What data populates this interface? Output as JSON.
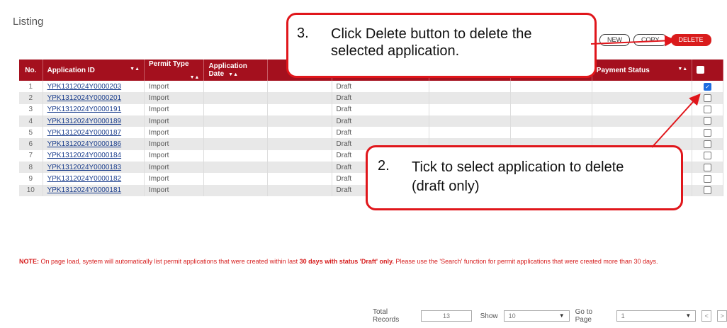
{
  "page": {
    "title": "Listing"
  },
  "toolbar": {
    "new_label": "NEW",
    "copy_label": "COPY",
    "delete_label": "DELETE"
  },
  "table": {
    "columns": {
      "no": "No.",
      "application_id": "Application ID",
      "permit_type": "Permit Type",
      "application_date": "Application Date",
      "payment_status": "Payment Status"
    },
    "rows": [
      {
        "no": "1",
        "id": "YPK1312024Y0000203",
        "type": "Import",
        "status": "Draft",
        "checked": true
      },
      {
        "no": "2",
        "id": "YPK1312024Y0000201",
        "type": "Import",
        "status": "Draft",
        "checked": false
      },
      {
        "no": "3",
        "id": "YPK1312024Y0000191",
        "type": "Import",
        "status": "Draft",
        "checked": false
      },
      {
        "no": "4",
        "id": "YPK1312024Y0000189",
        "type": "Import",
        "status": "Draft",
        "checked": false
      },
      {
        "no": "5",
        "id": "YPK1312024Y0000187",
        "type": "Import",
        "status": "Draft",
        "checked": false
      },
      {
        "no": "6",
        "id": "YPK1312024Y0000186",
        "type": "Import",
        "status": "Draft",
        "checked": false
      },
      {
        "no": "7",
        "id": "YPK1312024Y0000184",
        "type": "Import",
        "status": "Draft",
        "checked": false
      },
      {
        "no": "8",
        "id": "YPK1312024Y0000183",
        "type": "Import",
        "status": "Draft",
        "checked": false
      },
      {
        "no": "9",
        "id": "YPK1312024Y0000182",
        "type": "Import",
        "status": "Draft",
        "checked": false
      },
      {
        "no": "10",
        "id": "YPK1312024Y0000181",
        "type": "Import",
        "status": "Draft",
        "checked": false
      }
    ]
  },
  "note": {
    "prefix": "NOTE:",
    "part1": " On page load, system will automatically list permit applications that were created within last ",
    "bold": "30 days with status 'Draft' only.",
    "part2": " Please use the 'Search' function for permit applications that were created more than 30 days."
  },
  "footer": {
    "total_label": "Total Records",
    "total_value": "13",
    "show_label": "Show",
    "show_value": "10",
    "goto_label": "Go to Page",
    "goto_value": "1"
  },
  "callouts": {
    "step3": {
      "num": "3.",
      "text": "Click Delete button to delete the selected application."
    },
    "step2": {
      "num": "2.",
      "text": "Tick to select application to delete (draft only)"
    }
  },
  "colors": {
    "header": "#a4101e",
    "accent": "#e0161b",
    "link": "#1a3d8c"
  }
}
